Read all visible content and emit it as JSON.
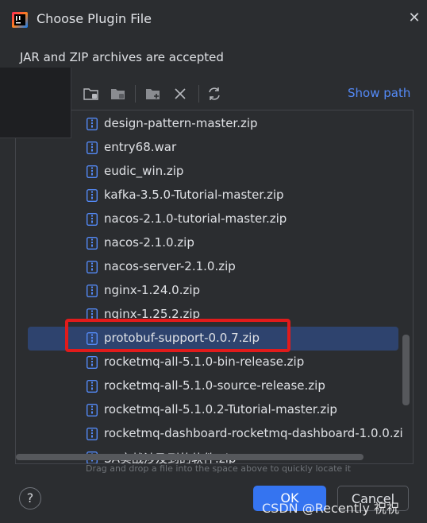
{
  "dialog": {
    "title": "Choose Plugin File",
    "subtitle": "JAR and ZIP archives are accepted",
    "close_icon": "close-icon",
    "app_icon": "intellij-icon"
  },
  "toolbar": {
    "icons": [
      "home-folder-icon",
      "project-folder-icon",
      "new-folder-icon",
      "delete-icon",
      "refresh-icon"
    ],
    "show_path_label": "Show path"
  },
  "files": [
    {
      "name": "design-pattern-master.zip",
      "selected": false
    },
    {
      "name": "entry68.war",
      "selected": false
    },
    {
      "name": "eudic_win.zip",
      "selected": false
    },
    {
      "name": "kafka-3.5.0-Tutorial-master.zip",
      "selected": false
    },
    {
      "name": "nacos-2.1.0-tutorial-master.zip",
      "selected": false
    },
    {
      "name": "nacos-2.1.0.zip",
      "selected": false
    },
    {
      "name": "nacos-server-2.1.0.zip",
      "selected": false
    },
    {
      "name": "nginx-1.24.0.zip",
      "selected": false
    },
    {
      "name": "nginx-1.25.2.zip",
      "selected": false
    },
    {
      "name": "protobuf-support-0.0.7.zip",
      "selected": true
    },
    {
      "name": "rocketmq-all-5.1.0-bin-release.zip",
      "selected": false
    },
    {
      "name": "rocketmq-all-5.1.0-source-release.zip",
      "selected": false
    },
    {
      "name": "rocketmq-all-5.1.0.2-Tutorial-master.zip",
      "selected": false
    },
    {
      "name": "rocketmq-dashboard-rocketmq-dashboard-1.0.0.zi",
      "selected": false
    },
    {
      "name": "SA实战涉及到的软件.zip",
      "selected": false
    }
  ],
  "hint": "Drag and drop a file into the space above to quickly locate it",
  "buttons": {
    "help_label": "?",
    "ok_label": "OK",
    "cancel_label": "Cancel"
  },
  "watermark": "CSDN @Recently 祝祝",
  "colors": {
    "accent": "#3574f0",
    "link": "#548af7",
    "selection": "#2e436e",
    "highlight_border": "#e11b1b",
    "background": "#2b2d30"
  }
}
